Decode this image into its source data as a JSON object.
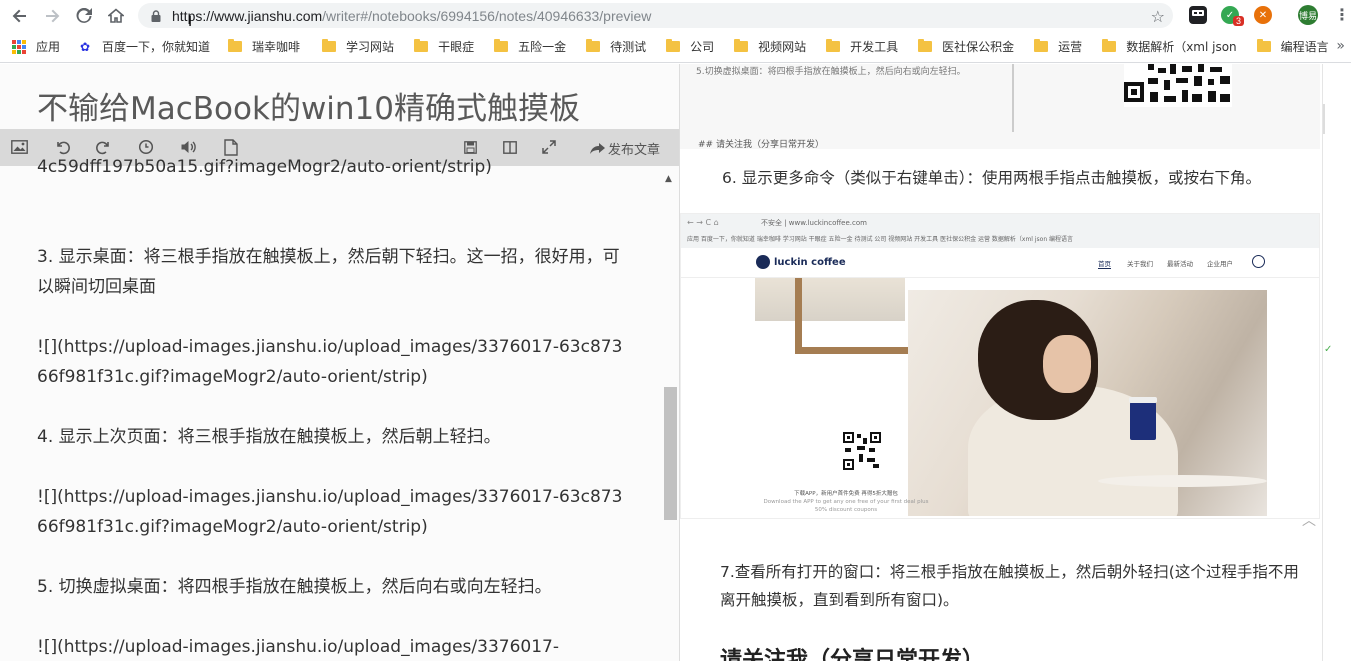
{
  "browser": {
    "url_host": "https://www.jianshu.com",
    "url_path": "/writer#/notebooks/6994156/notes/40946633/preview",
    "avatar_text": "博易",
    "badge_count": "3"
  },
  "bookmarks": [
    {
      "label": "应用",
      "icon": "apps-icon"
    },
    {
      "label": "百度一下，你就知道",
      "icon": "baidu-icon"
    },
    {
      "label": "瑞幸咖啡",
      "icon": "folder-icon"
    },
    {
      "label": "学习网站",
      "icon": "folder-icon"
    },
    {
      "label": "干眼症",
      "icon": "folder-icon"
    },
    {
      "label": "五险一金",
      "icon": "folder-icon"
    },
    {
      "label": "待测试",
      "icon": "folder-icon"
    },
    {
      "label": "公司",
      "icon": "folder-icon"
    },
    {
      "label": "视频网站",
      "icon": "folder-icon"
    },
    {
      "label": "开发工具",
      "icon": "folder-icon"
    },
    {
      "label": "医社保公积金",
      "icon": "folder-icon"
    },
    {
      "label": "运营",
      "icon": "folder-icon"
    },
    {
      "label": "数据解析（xml json",
      "icon": "folder-icon"
    },
    {
      "label": "编程语言",
      "icon": "folder-icon"
    }
  ],
  "editor": {
    "title": "不输给MacBook的win10精确式触摸板",
    "publish_label": "发布文章",
    "lines": [
      "4c59dff197b50a15.gif?imageMogr2/auto-orient/strip)",
      "",
      "",
      "3. 显示桌面：将三根手指放在触摸板上，然后朝下轻扫。这一招，很好用，可以瞬间切回桌面",
      "",
      "![](https://upload-images.jianshu.io/upload_images/3376017-63c87366f981f31c.gif?imageMogr2/auto-orient/strip)",
      "",
      "4. 显示上次页面：将三根手指放在触摸板上，然后朝上轻扫。",
      "",
      "![](https://upload-images.jianshu.io/upload_images/3376017-63c87366f981f31c.gif?imageMogr2/auto-orient/strip)",
      "",
      "5. 切换虚拟桌面：将四根手指放在触摸板上，然后向右或向左轻扫。",
      "",
      "![](https://upload-images.jianshu.io/upload_images/3376017-"
    ]
  },
  "preview": {
    "small_caption": "5.切换虚拟桌面：将四根手指放在触摸板上，然后向右或向左轻扫。",
    "small_heading": "## 请关注我（分享日常开发）",
    "item6": "6. 显示更多命令（类似于右键单击）：使用两根手指点击触摸板，或按右下角。",
    "item7": "7.查看所有打开的窗口：将三根手指放在触摸板上，然后朝外轻扫(这个过程手指不用离开触摸板，直到看到所有窗口)。",
    "section_title": "请关注我（分享日常开发）",
    "shot": {
      "url": "不安全 | www.luckincoffee.com",
      "logo": "luckin coffee",
      "menu": [
        "首页",
        "关于我们",
        "最新活动",
        "企业用户"
      ],
      "bookmarks": "应用  百度一下，你就知道  瑞幸咖啡  学习网站  干眼症  五险一金  待测试  公司  视频网站  开发工具  医社保公积金  运营  数据解析（xml json  编程语言",
      "download_cn": "下载APP，新用户首件免费 再得5折大赠包",
      "download_en": "Download the APP to get any one free of your first deal plus 50% discount coupons"
    }
  }
}
